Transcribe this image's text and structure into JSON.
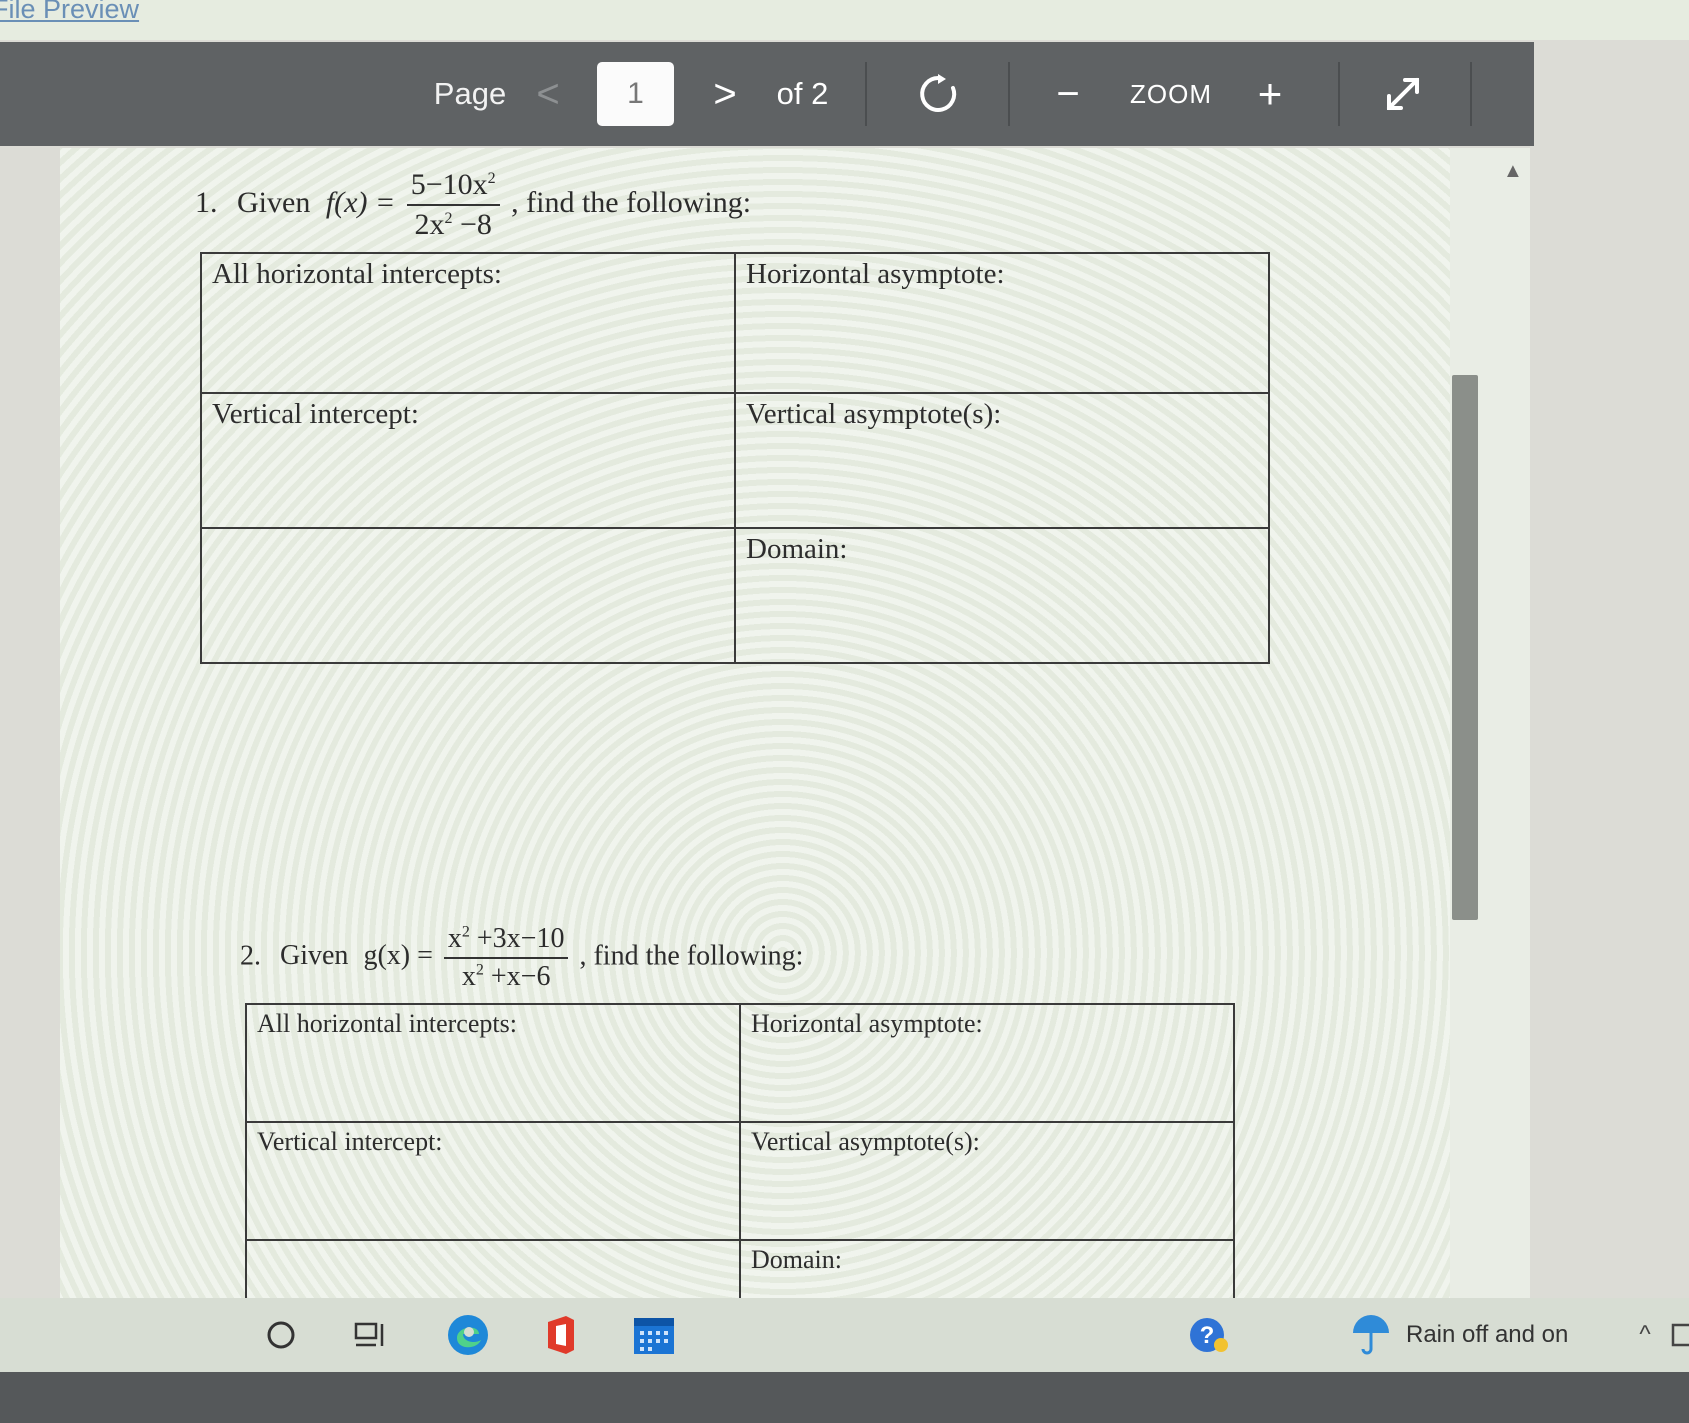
{
  "header": {
    "file_preview": "File Preview"
  },
  "toolbar": {
    "page_label": "Page",
    "prev_glyph": "<",
    "page_number": "1",
    "next_glyph": ">",
    "of_total": "of 2",
    "minus": "−",
    "zoom_label": "ZOOM",
    "plus": "+"
  },
  "q1": {
    "number": "1.",
    "given": "Given",
    "func": "f(x) =",
    "numerator": "5−10x",
    "denominator": "2x",
    "den_tail": " −8",
    "sup": "2",
    "find": ", find the following:",
    "cells": {
      "h_intercepts": "All horizontal intercepts:",
      "h_asymptote": "Horizontal asymptote:",
      "v_intercept": "Vertical intercept:",
      "v_asymptotes": "Vertical asymptote(s):",
      "empty": "",
      "domain": "Domain:"
    }
  },
  "q2": {
    "number": "2.",
    "given": "Given",
    "func": "g(x) =",
    "num_a": "x",
    "num_b": " +3x−10",
    "den_a": "x",
    "den_b": " +x−6",
    "sup": "2",
    "find": ", find the following:",
    "cells": {
      "h_intercepts": "All horizontal intercepts:",
      "h_asymptote": "Horizontal asymptote:",
      "v_intercept": "Vertical intercept:",
      "v_asymptotes": "Vertical asymptote(s):",
      "empty": "",
      "domain": "Domain:"
    }
  },
  "taskbar": {
    "weather_text": "Rain off and on",
    "chevron": "^",
    "icons": [
      "search-icon",
      "task-view-icon",
      "edge-icon",
      "office-icon",
      "calendar-icon",
      "help-icon",
      "umbrella-icon"
    ]
  }
}
